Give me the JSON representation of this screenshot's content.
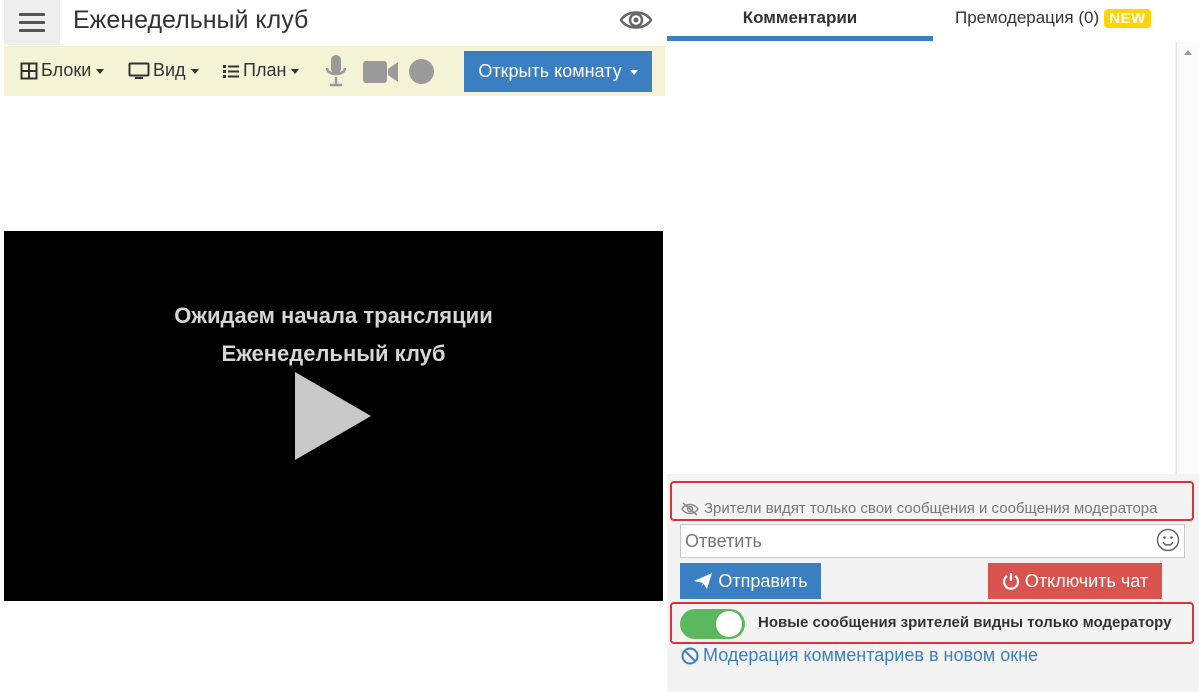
{
  "header": {
    "title": "Еженедельный клуб",
    "menu_icon": "hamburger-menu-icon",
    "visibility_icon": "eye-icon"
  },
  "toolbar": {
    "blocks_label": "Блоки",
    "view_label": "Вид",
    "plan_label": "План",
    "icons": [
      "grid-icon",
      "monitor-icon",
      "list-icon",
      "microphone-icon",
      "video-camera-icon",
      "record-icon"
    ],
    "open_room_label": "Открыть комнату"
  },
  "video": {
    "line1": "Ожидаем начала трансляции",
    "line2": "Еженедельный клуб",
    "play_icon": "play-icon"
  },
  "tabs": {
    "comments_label": "Комментарии",
    "premoderation_label": "Премодерация (0)",
    "new_badge": "NEW"
  },
  "chat": {
    "notice": "Зрители видят только свои сообщения и сообщения модератора",
    "reply_placeholder": "Ответить",
    "send_label": "Отправить",
    "disable_label": "Отключить чат",
    "toggle_label": "Новые сообщения зрителей видны только модератору",
    "toggle_on": true,
    "moderation_link": "Модерация комментариев в новом окне"
  },
  "colors": {
    "accent_blue": "#3a7fc1",
    "danger_red": "#d9534f",
    "toggle_green": "#5cb85c",
    "toolbar_bg": "#f5f3d6",
    "highlight_red": "#d9343a",
    "badge_yellow": "#ffd400"
  }
}
